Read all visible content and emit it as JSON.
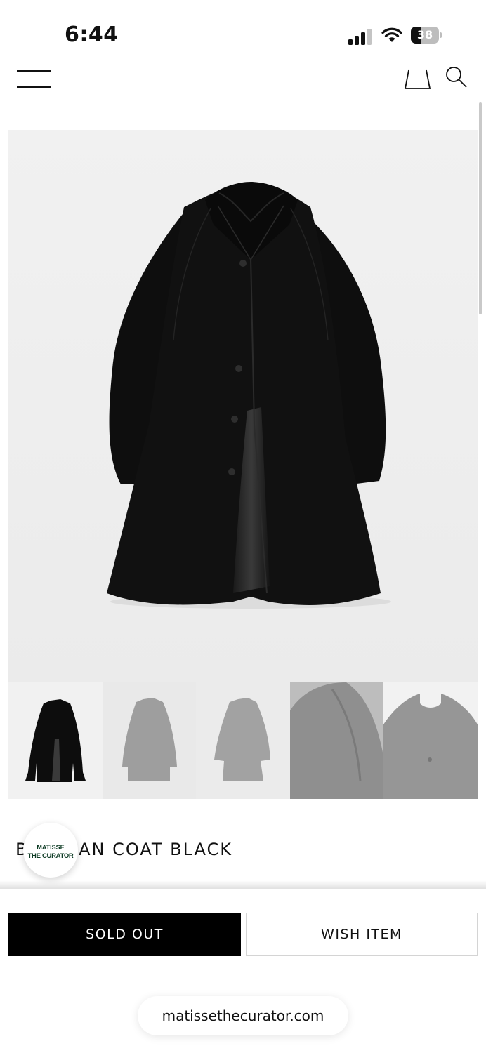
{
  "status_bar": {
    "time": "6:44",
    "battery_level": "38",
    "battery_fraction": 0.38,
    "signal_bars": 3
  },
  "header": {
    "menu_icon": "hamburger-menu-icon",
    "bag_icon": "shopping-bag-icon",
    "search_icon": "search-icon"
  },
  "product": {
    "title": "BALCAAN COAT BLACK",
    "main_image_alt": "black-coat",
    "thumbnails": [
      {
        "icon": "coat-front-thumbnail",
        "active": true
      },
      {
        "icon": "coat-front-thumbnail",
        "active": false
      },
      {
        "icon": "coat-front-thumbnail",
        "active": false
      },
      {
        "icon": "coat-detail-thumbnail",
        "active": false
      },
      {
        "icon": "coat-collar-detail-thumbnail",
        "active": false
      }
    ]
  },
  "brand_badge": {
    "line1": "MATISSE",
    "line2": "THE CURATOR",
    "color": "#0d3b24"
  },
  "actions": {
    "sold_out_label": "SOLD OUT",
    "wish_label": "WISH ITEM"
  },
  "browser": {
    "url": "matissethecurator.com"
  }
}
